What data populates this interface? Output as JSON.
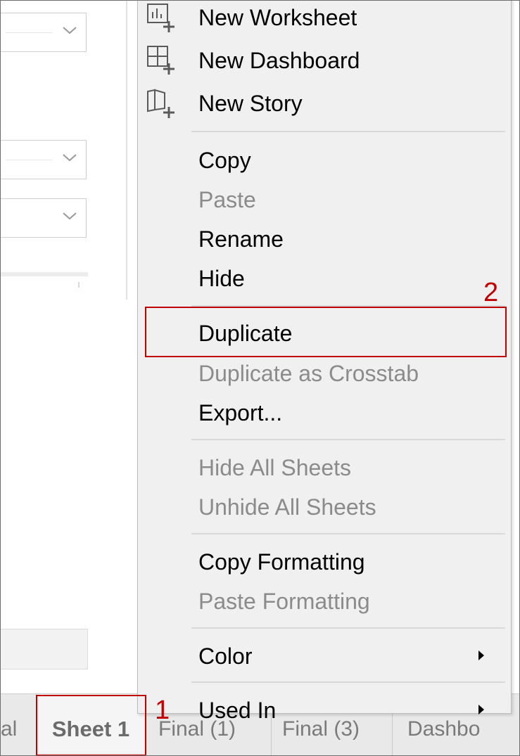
{
  "menu": {
    "items": [
      {
        "label": "New Worksheet",
        "enabled": true,
        "icon": "new-worksheet-icon"
      },
      {
        "label": "New Dashboard",
        "enabled": true,
        "icon": "new-dashboard-icon"
      },
      {
        "label": "New Story",
        "enabled": true,
        "icon": "new-story-icon"
      },
      {
        "label": "Copy",
        "enabled": true
      },
      {
        "label": "Paste",
        "enabled": false
      },
      {
        "label": "Rename",
        "enabled": true
      },
      {
        "label": "Hide",
        "enabled": true
      },
      {
        "label": "Duplicate",
        "enabled": true,
        "highlighted": true
      },
      {
        "label": "Duplicate as Crosstab",
        "enabled": false
      },
      {
        "label": "Export...",
        "enabled": true
      },
      {
        "label": "Hide All Sheets",
        "enabled": false
      },
      {
        "label": "Unhide All Sheets",
        "enabled": false
      },
      {
        "label": "Copy Formatting",
        "enabled": true
      },
      {
        "label": "Paste Formatting",
        "enabled": false
      },
      {
        "label": "Color",
        "enabled": true,
        "submenu": true
      },
      {
        "label": "Used In",
        "enabled": true,
        "submenu": true
      }
    ]
  },
  "tabs": {
    "partial_left": "al",
    "active": "Sheet 1",
    "others": [
      "Final (1)",
      "Final (3)",
      "Dashbo"
    ]
  },
  "annotations": {
    "step1": "1",
    "step2": "2"
  },
  "colors": {
    "annotation": "#c00000",
    "menu_bg": "#f0f0f0",
    "disabled_text": "#8b8b8b"
  }
}
